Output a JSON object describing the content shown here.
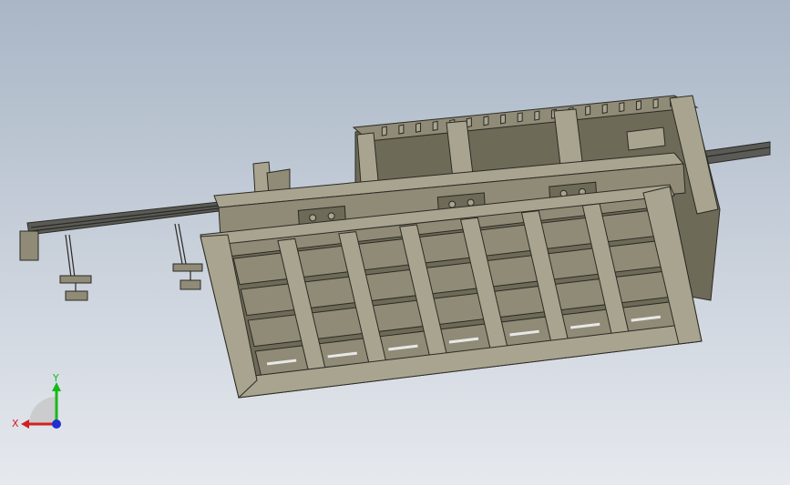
{
  "viewport": {
    "background_top": "#a9b6c6",
    "background_bottom": "#e6e9ee"
  },
  "model": {
    "body_color": "#8f8b77",
    "body_dark": "#6e6a58",
    "body_light": "#a8a48f",
    "edge_color": "#2b2a24",
    "rail_color": "#5a5a56"
  },
  "triad": {
    "x_label": "X",
    "y_label": "Y",
    "x_color": "#d42020",
    "y_color": "#18b818",
    "z_color": "#2030d0",
    "plane_color": "#c8c8c8"
  }
}
